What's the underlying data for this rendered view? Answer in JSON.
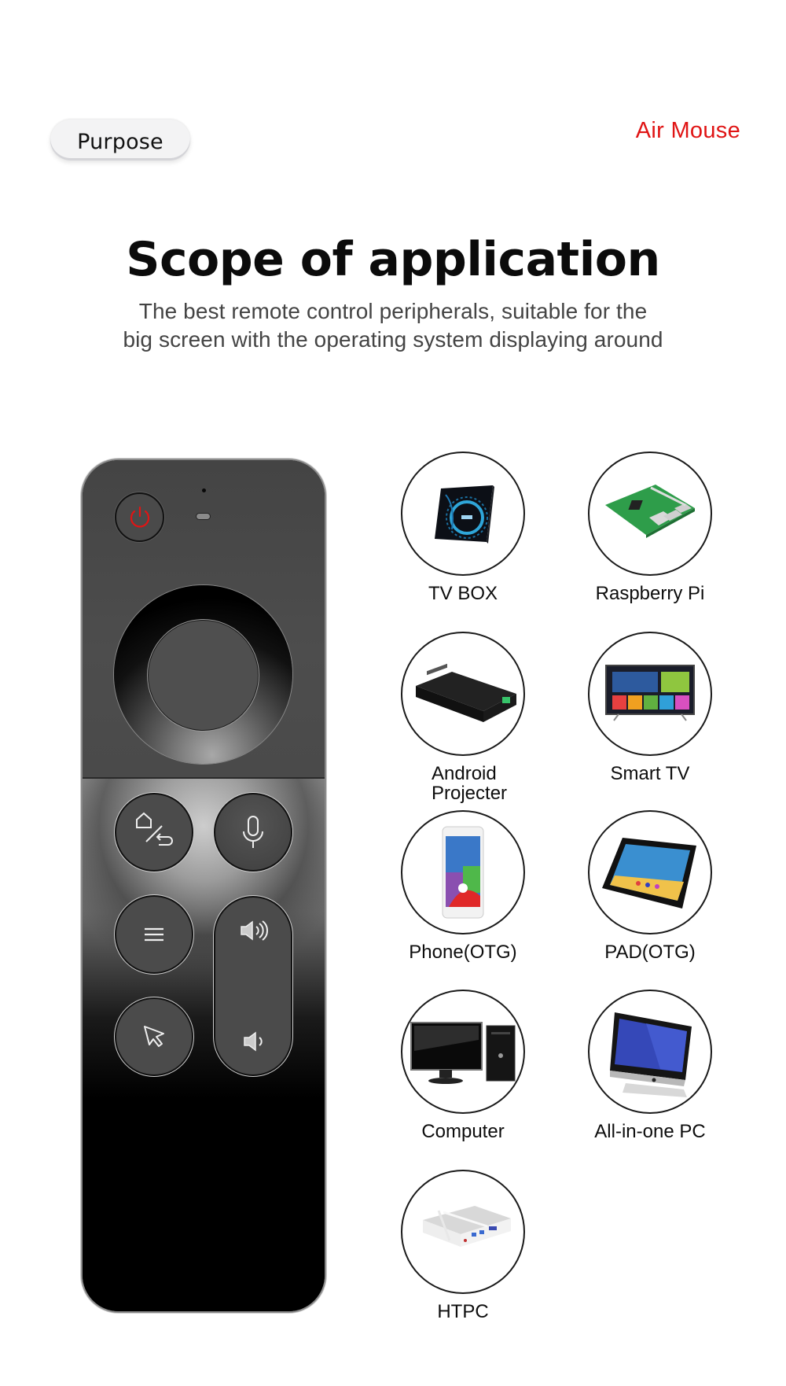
{
  "header": {
    "tag_label": "Purpose",
    "brand_label": "Air Mouse"
  },
  "hero": {
    "title": "Scope of application",
    "subtitle_lines": [
      "The best remote control peripherals, suitable for the",
      "big screen with the operating system displaying around"
    ]
  },
  "remote": {
    "buttons": [
      {
        "name": "power",
        "icon": "power-icon",
        "color": "#e01414"
      },
      {
        "name": "dpad",
        "icon": "dpad-icon"
      },
      {
        "name": "home-back",
        "icon": "home-back-icon"
      },
      {
        "name": "voice",
        "icon": "microphone-icon"
      },
      {
        "name": "menu",
        "icon": "menu-icon"
      },
      {
        "name": "volume-up",
        "icon": "volume-up-icon"
      },
      {
        "name": "volume-down",
        "icon": "volume-down-icon"
      },
      {
        "name": "mouse-mode",
        "icon": "cursor-icon"
      }
    ]
  },
  "devices": [
    {
      "label": "TV BOX",
      "icon": "tv-box-icon"
    },
    {
      "label": "Raspberry Pi",
      "icon": "raspberry-pi-icon"
    },
    {
      "label": "Android Projecter",
      "icon": "projector-icon"
    },
    {
      "label": "Smart TV",
      "icon": "smart-tv-icon"
    },
    {
      "label": "Phone(OTG)",
      "icon": "phone-icon"
    },
    {
      "label": "PAD(OTG)",
      "icon": "tablet-icon"
    },
    {
      "label": "Computer",
      "icon": "desktop-computer-icon"
    },
    {
      "label": "All-in-one PC",
      "icon": "all-in-one-pc-icon"
    },
    {
      "label": "HTPC",
      "icon": "htpc-icon"
    }
  ],
  "colors": {
    "accent": "#e01414",
    "remote_body": "#4a4a4a"
  }
}
